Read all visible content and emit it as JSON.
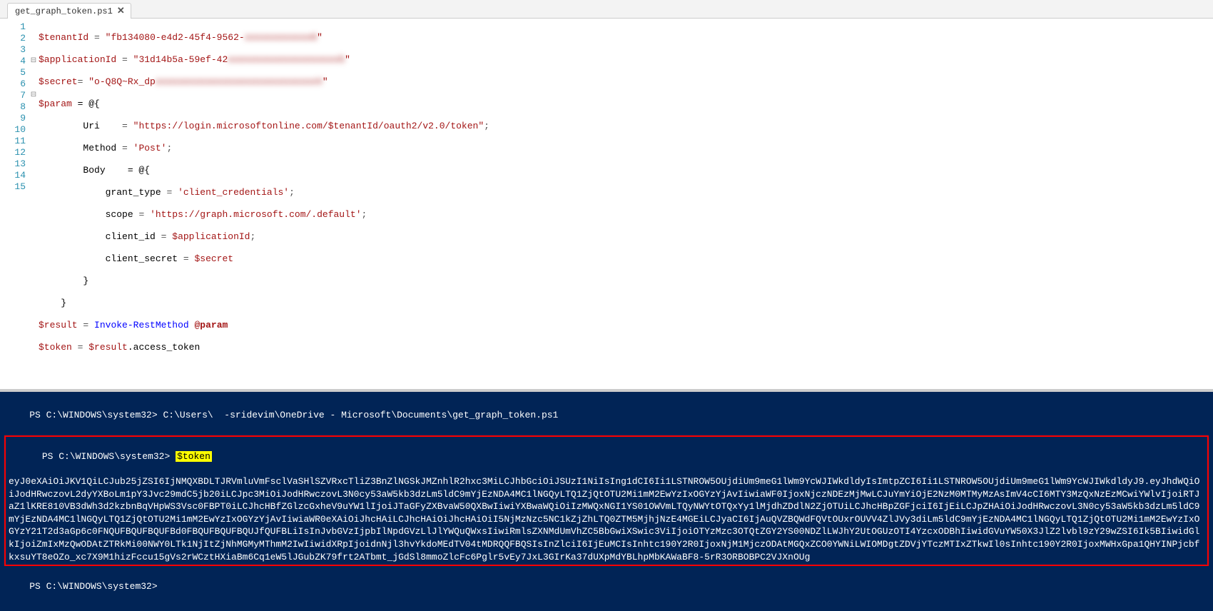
{
  "tab": {
    "title": "get_graph_token.ps1"
  },
  "code": {
    "line1_var": "$tenantId",
    "line1_val_a": "\"fb134080-e4d2-45f4-9562-",
    "line1_val_blur": "xxxxxxxxxxxx0",
    "line1_val_c": "\"",
    "line2_var": "$applicationId",
    "line2_val_a": "\"31d14b5a-59ef-42",
    "line2_val_blur": "xxxxxxxxxxxxxxxxxxxx5",
    "line2_val_c": "\"",
    "line3_var": "$secret",
    "line3_val_a": "\"o-Q8Q~Rx_dp",
    "line3_val_blur": "xxxxxxxxxxxxxxxxxxxxxxxxxxxxxV",
    "line3_val_c": "\"",
    "line4_var": "$param",
    "line4_rhs": " = @{",
    "line5_lbl": "Uri    ",
    "line5_val": "\"https://login.microsoftonline.com/$tenantId/oauth2/v2.0/token\"",
    "line6_lbl": "Method ",
    "line6_val": "'Post'",
    "line7_lbl": "Body   ",
    "line7_rhs": " = @{",
    "line8_lbl": "grant_type ",
    "line8_val": "'client_credentials'",
    "line9_lbl": "scope ",
    "line9_val": "'https://graph.microsoft.com/.default'",
    "line10_lbl": "client_id ",
    "line10_val": "$applicationId",
    "line11_lbl": "client_secret ",
    "line11_val": "$secret",
    "line12": "        }",
    "line13": "    }",
    "line14_var": "$result",
    "line14_fn": "Invoke-RestMethod",
    "line14_arg": "@param",
    "line15_var": "$token",
    "line15_rhs_var": "$result",
    "line15_mem": ".access_token"
  },
  "gutter": [
    "1",
    "2",
    "3",
    "4",
    "5",
    "6",
    "7",
    "8",
    "9",
    "10",
    "11",
    "12",
    "13",
    "14",
    "15"
  ],
  "fold": [
    "",
    "",
    "",
    "⊟",
    "",
    "",
    "⊟",
    "",
    "",
    "",
    "",
    "",
    "",
    "",
    ""
  ],
  "term": {
    "prompt": "PS C:\\WINDOWS\\system32>",
    "cmd1": "C:\\Users\\  -sridevim\\OneDrive - Microsoft\\Documents\\get_graph_token.ps1",
    "cmd2": "$token",
    "output": "eyJ0eXAiOiJKV1QiLCJub25jZSI6IjNMQXBDLTJRVmluVmFsclVaSHlSZVRxcTliZ3BnZlNGSkJMZnhlR2hxc3MiLCJhbGciOiJSUzI1NiIsIng1dCI6Ii1LSTNROW5OUjdiUm9meG1lWm9YcWJIWkdldyIsImtpZCI6Ii1LSTNROW5OUjdiUm9meG1lWm9YcWJIWkdldyJ9.eyJhdWQiOiJodHRwczovL2dyYXBoLm1pY3Jvc29mdC5jb20iLCJpc3MiOiJodHRwczovL3N0cy53aW5kb3dzLm5ldC9mYjEzNDA4MC1lNGQyLTQ1ZjQtOTU2Mi1mM2EwYzIxOGYzYjAvIiwiaWF0IjoxNjczNDEzMjMwLCJuYmYiOjE2NzM0MTMyMzAsImV4cCI6MTY3MzQxNzEzMCwiYWlvIjoiRTJaZ1lKRE810VB3dWh3d2kzbnBqVHpWS3Vsc0FBPT0iLCJhcHBfZGlzcGxheV9uYW1lIjoiJTaGFyZXBvaW50QXBwIiwiYXBwaWQiOiIzMWQxNGI1YS01OWVmLTQyNWYtOTQxYy1lMjdhZDdlN2ZjOTUiLCJhcHBpZGFjciI6IjEiLCJpZHAiOiJodHRwczovL3N0cy53aW5kb3dzLm5ldC9mYjEzNDA4MC1lNGQyLTQ1ZjQtOTU2Mi1mM2EwYzIxOGYzYjAvIiwiaWR0eXAiOiJhcHAiLCJhcHAiOiJhcHAiOiI5NjMzNzc5NC1kZjZhLTQ0ZTM5MjhjNzE4MGEiLCJyaCI6IjAuQVZBQWdFQVtOUxrOUVV4ZlJVy3diLm5ldC9mYjEzNDA4MC1lNGQyLTQ1ZjQtOTU2Mi1mM2EwYzIxOGYzY21T2d3aGp6c0FNQUFBQUFBQUFBd0FBQUFBQUFBQUJfQUFBLiIsInJvbGVzIjpbIlNpdGVzLlJlYWQuQWxsIiwiRmlsZXNMdUmVhZC5BbGwiXSwic3ViIjoiOTYzMzc3OTQtZGY2YS00NDZlLWJhY2UtOGUzOTI4YzcxODBhIiwidGVuYW50X3JlZ2lvbl9zY29wZSI6Ik5BIiwidGlkIjoiZmIxMzQwODAtZTRkMi00NWY0LTk1NjItZjNhMGMyMThmM2IwIiwidXRpIjoidnNjl3hvYkdoMEdTV04tMDRQQFBQSIsInZlciI6IjEuMCIsInhtc190Y2R0IjoxNjM1MjczODAtMGQxZCO0YWNiLWIOMDgtZDVjYTczMTIxZTkwIl0sInhtc190Y2R0IjoxMWHxGpa1QHYINPjcbfkxsuYT8eOZo_xc7X9M1hizFccu15gVs2rWCztHXiaBm6Cq1eW5lJGubZK79frt2ATbmt_jGdSl8mmoZlcFc6Pglr5vEy7JxL3GIrKa37dUXpMdYBLhpMbKAWaBF8-5rR3ORBOBPC2VJXnOUg",
    "prompt3": "PS C:\\WINDOWS\\system32>"
  }
}
